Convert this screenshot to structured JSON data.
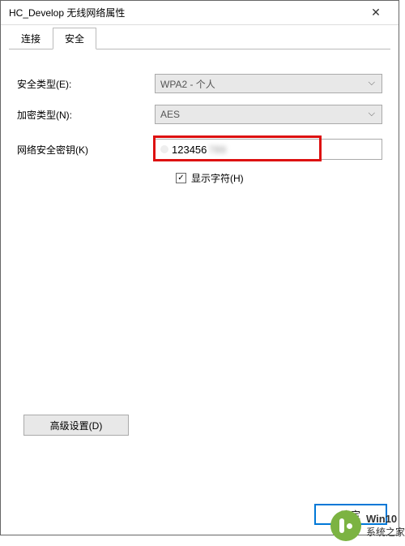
{
  "window": {
    "title": "HC_Develop 无线网络属性"
  },
  "tabs": {
    "connect": "连接",
    "security": "安全"
  },
  "form": {
    "security_type_label": "安全类型(E):",
    "security_type_value": "WPA2 - 个人",
    "encryption_type_label": "加密类型(N):",
    "encryption_type_value": "AES",
    "network_key_label": "网络安全密钥(K)",
    "network_key_value": "123456",
    "network_key_hidden_suffix": "789",
    "show_chars_label": "显示字符(H)",
    "show_chars_checked": true
  },
  "buttons": {
    "advanced": "高级设置(D)",
    "ok": "确定"
  },
  "watermark": {
    "line1": "Win10",
    "line2": "系统之家"
  }
}
